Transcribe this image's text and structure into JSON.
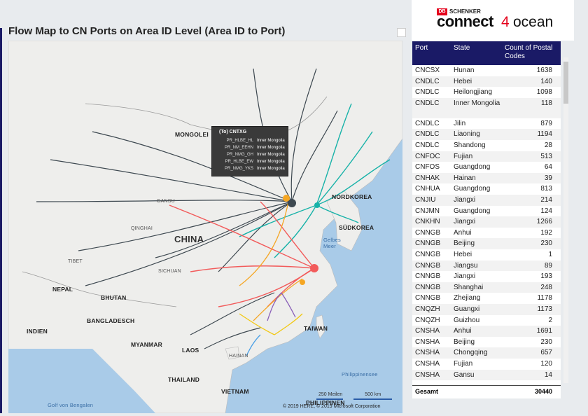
{
  "title": "Flow Map to CN Ports on Area ID Level (Area ID to Port)",
  "logo": {
    "db": "DB",
    "schenker": "SCHENKER",
    "connect": "connect",
    "four": "4",
    "ocean": "ocean"
  },
  "map": {
    "labels": {
      "mongolei": "MONGOLEI",
      "china": "CHINA",
      "nordkorea": "NORDKOREA",
      "suedkorea": "SÜDKOREA",
      "gelbes_meer": "Gelbes Meer",
      "taiwan": "TAIWAN",
      "nepal": "NEPAL",
      "bhutan": "BHUTAN",
      "bangladesch": "BANGLADESCH",
      "indien": "INDIEN",
      "myanmar": "MYANMAR",
      "laos": "LAOS",
      "thailand": "THAILAND",
      "vietnam": "VIETNAM",
      "hainan": "HAINAN",
      "philippinensee": "Philippinensee",
      "golf": "Golf von Bengalen",
      "philippinen": "PHILIPPINEN",
      "gansu": "GANSU",
      "qinghai": "QINGHAI",
      "tibet": "TIBET",
      "sichuan": "SICHUAN"
    },
    "scale": {
      "miles": "250 Meilen",
      "km": "500 km"
    },
    "copyright": "© 2019 HERE, © 2019 Microsoft Corporation",
    "colors": {
      "dark": "#3d4850",
      "teal": "#17b2a8",
      "red": "#f25b5b",
      "orange": "#f5a623",
      "purple": "#8a5fb8",
      "yellow": "#f2c811",
      "blue": "#4aa0e6"
    },
    "tooltip": {
      "title": "(To) CNTXG",
      "rows": [
        {
          "area": "PR_HLBE_HL",
          "state": "Inner Mongolia"
        },
        {
          "area": "PR_NM_EEHN",
          "state": "Inner Mongolia"
        },
        {
          "area": "PR_NMG_GH",
          "state": "Inner Mongolia"
        },
        {
          "area": "PR_HLBE_EW",
          "state": "Inner Mongolia"
        },
        {
          "area": "PR_NMG_YKS",
          "state": "Inner Mongolia"
        }
      ]
    }
  },
  "table": {
    "headers": {
      "port": "Port",
      "state": "State",
      "count": "Count of Postal Codes"
    },
    "rows": [
      {
        "port": "CNCSX",
        "state": "Hunan",
        "count": "1638"
      },
      {
        "port": "CNDLC",
        "state": "Hebei",
        "count": "140"
      },
      {
        "port": "CNDLC",
        "state": "Heilongjiang",
        "count": "1098"
      },
      {
        "port": "CNDLC",
        "state": "Inner Mongolia",
        "count": "118"
      },
      {
        "port": "CNDLC",
        "state": "Jilin",
        "count": "879"
      },
      {
        "port": "CNDLC",
        "state": "Liaoning",
        "count": "1194"
      },
      {
        "port": "CNDLC",
        "state": "Shandong",
        "count": "28"
      },
      {
        "port": "CNFOC",
        "state": "Fujian",
        "count": "513"
      },
      {
        "port": "CNFOS",
        "state": "Guangdong",
        "count": "64"
      },
      {
        "port": "CNHAK",
        "state": "Hainan",
        "count": "39"
      },
      {
        "port": "CNHUA",
        "state": "Guangdong",
        "count": "813"
      },
      {
        "port": "CNJIU",
        "state": "Jiangxi",
        "count": "214"
      },
      {
        "port": "CNJMN",
        "state": "Guangdong",
        "count": "124"
      },
      {
        "port": "CNKHN",
        "state": "Jiangxi",
        "count": "1266"
      },
      {
        "port": "CNNGB",
        "state": "Anhui",
        "count": "192"
      },
      {
        "port": "CNNGB",
        "state": "Beijing",
        "count": "230"
      },
      {
        "port": "CNNGB",
        "state": "Hebei",
        "count": "1"
      },
      {
        "port": "CNNGB",
        "state": "Jiangsu",
        "count": "89"
      },
      {
        "port": "CNNGB",
        "state": "Jiangxi",
        "count": "193"
      },
      {
        "port": "CNNGB",
        "state": "Shanghai",
        "count": "248"
      },
      {
        "port": "CNNGB",
        "state": "Zhejiang",
        "count": "1178"
      },
      {
        "port": "CNQZH",
        "state": "Guangxi",
        "count": "1173"
      },
      {
        "port": "CNQZH",
        "state": "Guizhou",
        "count": "2"
      },
      {
        "port": "CNSHA",
        "state": "Anhui",
        "count": "1691"
      },
      {
        "port": "CNSHA",
        "state": "Beijing",
        "count": "230"
      },
      {
        "port": "CNSHA",
        "state": "Chongqing",
        "count": "657"
      },
      {
        "port": "CNSHA",
        "state": "Fujian",
        "count": "120"
      },
      {
        "port": "CNSHA",
        "state": "Gansu",
        "count": "14"
      }
    ],
    "total": {
      "label": "Gesamt",
      "value": "30440"
    }
  }
}
